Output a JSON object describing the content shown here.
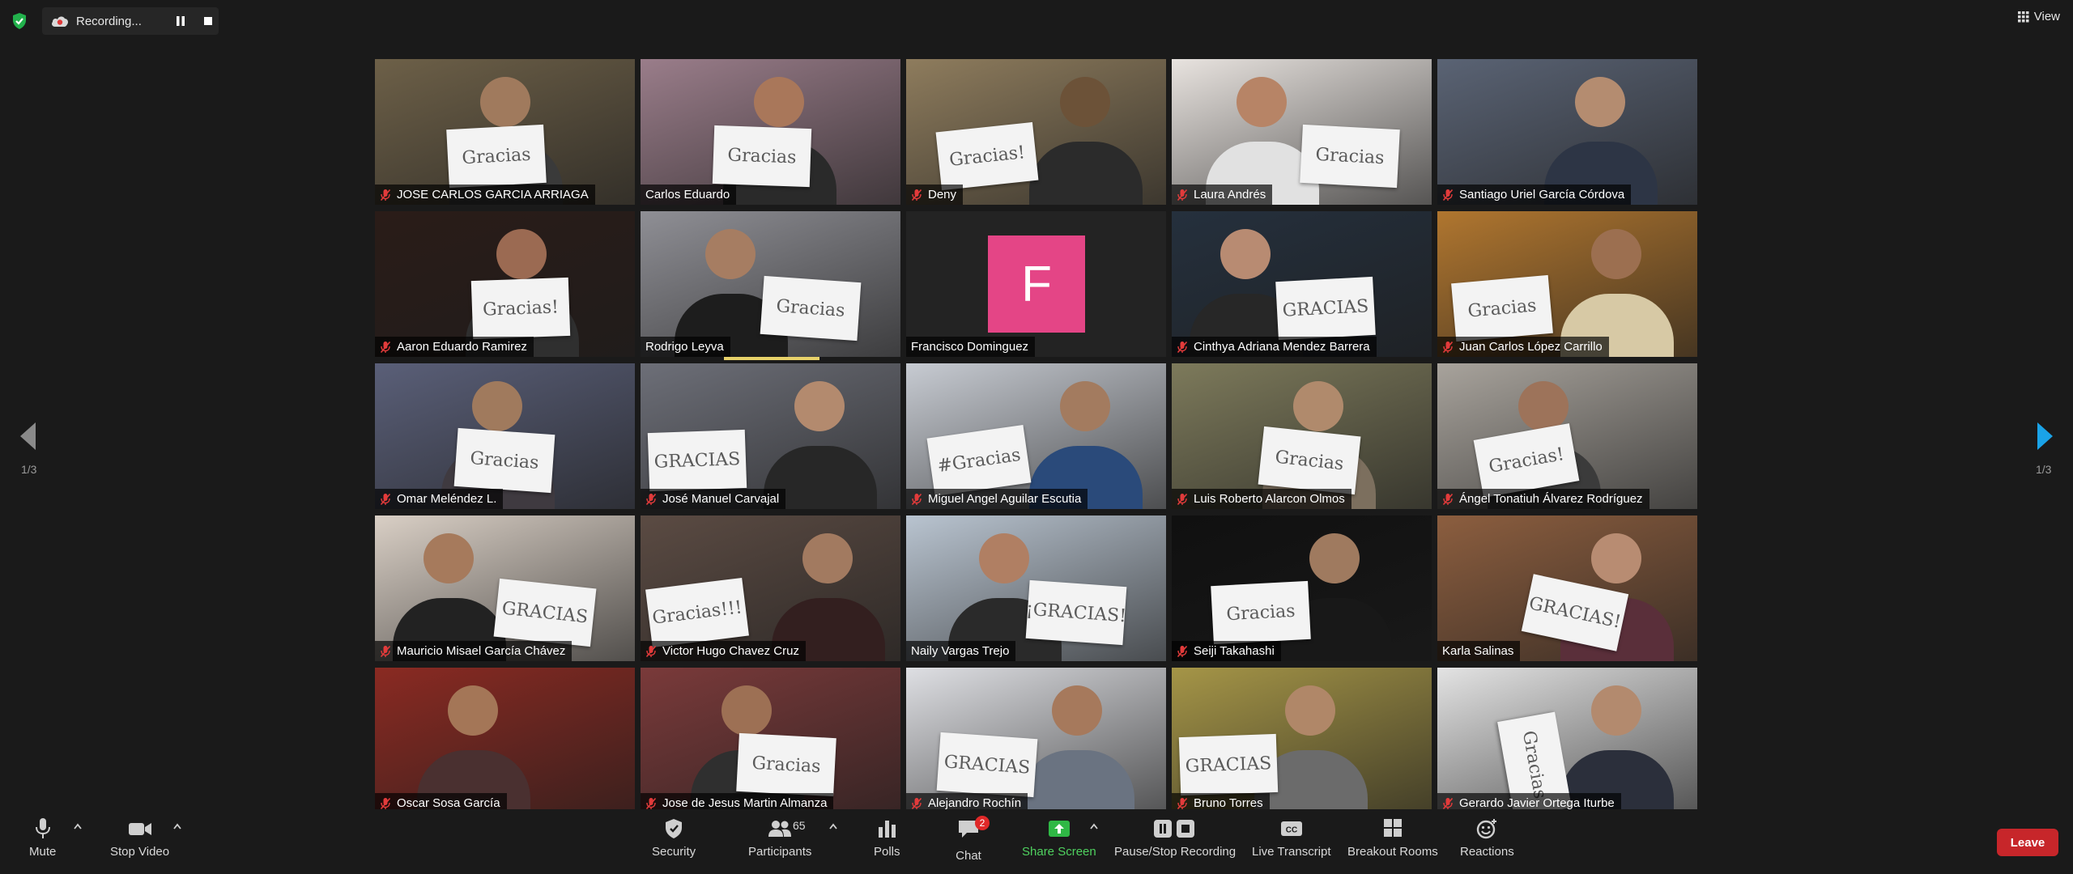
{
  "recording": {
    "label": "Recording..."
  },
  "view": {
    "label": "View"
  },
  "participants": [
    {
      "name": "JOSE CARLOS GARCIA ARRIAGA",
      "muted": true,
      "sign": "Gracias",
      "bg": "#6d6048",
      "skin": "#a07a5d",
      "shirt": "#3a3a3a"
    },
    {
      "name": "Carlos Eduardo",
      "muted": false,
      "sign": "Gracias",
      "bg": "#9a7d8a",
      "skin": "#a9775a",
      "shirt": "#2a2a2a",
      "active": true
    },
    {
      "name": "Deny",
      "muted": true,
      "sign": "Gracias!",
      "bg": "#8e7c5d",
      "skin": "#6c5238",
      "shirt": "#2b2b2b"
    },
    {
      "name": "Laura Andrés",
      "muted": true,
      "sign": "Gracias",
      "bg": "#e8e3df",
      "skin": "#b78466",
      "shirt": "#e1e1e1"
    },
    {
      "name": "Santiago Uriel García Córdova",
      "muted": true,
      "sign": "",
      "bg": "#5a6374",
      "skin": "#b48c70",
      "shirt": "#2d3545"
    },
    {
      "name": "Aaron Eduardo Ramirez",
      "muted": true,
      "sign": "Gracias!",
      "bg": "#2a1c18",
      "skin": "#9b6a52",
      "shirt": "#2f2f2f"
    },
    {
      "name": "Rodrigo Leyva",
      "muted": false,
      "sign": "Gracias",
      "bg": "#8f8f95",
      "skin": "#a67d62",
      "shirt": "#1d1d1d"
    },
    {
      "name": "Francisco Dominguez",
      "muted": false,
      "sign": "",
      "avatar": "F"
    },
    {
      "name": "Cinthya Adriana Mendez Barrera",
      "muted": true,
      "sign": "GRACIAS",
      "bg": "#25303d",
      "skin": "#b88b72",
      "shirt": "#272727"
    },
    {
      "name": "Juan Carlos López Carrillo",
      "muted": true,
      "sign": "Gracias",
      "bg": "#b0762f",
      "skin": "#9c6f50",
      "shirt": "#d7c9a5"
    },
    {
      "name": "Omar Meléndez L.",
      "muted": true,
      "sign": "Gracias",
      "bg": "#5a5f78",
      "skin": "#a07a5d",
      "shirt": "#3f3a40"
    },
    {
      "name": "José Manuel Carvajal",
      "muted": true,
      "sign": "GRACIAS",
      "bg": "#6d6f78",
      "skin": "#b38a6e",
      "shirt": "#272727"
    },
    {
      "name": "Miguel Angel Aguilar Escutia",
      "muted": true,
      "sign": "#Gracias",
      "bg": "#c7cbd2",
      "skin": "#a37b5f",
      "shirt": "#2a4a7a"
    },
    {
      "name": "Luis Roberto Alarcon Olmos",
      "muted": true,
      "sign": "Gracias",
      "bg": "#7d7a5b",
      "skin": "#b08a6c",
      "shirt": "#7c6f5e"
    },
    {
      "name": "Ángel Tonatiuh Álvarez Rodríguez",
      "muted": true,
      "sign": "Gracias!",
      "bg": "#a8a39c",
      "skin": "#9d735a",
      "shirt": "#3b3b3b"
    },
    {
      "name": "Mauricio Misael García Chávez",
      "muted": true,
      "sign": "GRACIAS",
      "bg": "#d9cfc5",
      "skin": "#a67a5c",
      "shirt": "#222222"
    },
    {
      "name": "Victor Hugo Chavez Cruz",
      "muted": true,
      "sign": "Gracias!!!",
      "bg": "#5b4b43",
      "skin": "#a27a60",
      "shirt": "#331f1f"
    },
    {
      "name": "Naily Vargas Trejo",
      "muted": false,
      "sign": "¡GRACIAS!",
      "bg": "#b9c4d0",
      "skin": "#b07f63",
      "shirt": "#2a2a2a"
    },
    {
      "name": "Seiji Takahashi",
      "muted": true,
      "sign": "Gracias",
      "bg": "#101010",
      "skin": "#9f7a5f",
      "shirt": "#181818"
    },
    {
      "name": "Karla Salinas",
      "muted": false,
      "sign": "GRACIAS!",
      "bg": "#8c5e3f",
      "skin": "#b88c72",
      "shirt": "#5a2f3a"
    },
    {
      "name": "Oscar Sosa García",
      "muted": true,
      "sign": "",
      "bg": "#8a2a22",
      "skin": "#a47657",
      "shirt": "#4a3030"
    },
    {
      "name": "Jose de Jesus Martin Almanza",
      "muted": true,
      "sign": "Gracias",
      "bg": "#7a3a3a",
      "skin": "#9d7054",
      "shirt": "#2f2f2f"
    },
    {
      "name": "Alejandro Rochín",
      "muted": true,
      "sign": "GRACIAS",
      "bg": "#dedfe3",
      "skin": "#a6795c",
      "shirt": "#6a7381"
    },
    {
      "name": "Bruno Torres",
      "muted": true,
      "sign": "GRACIAS",
      "bg": "#a59547",
      "skin": "#b08768",
      "shirt": "#6b6b6b"
    },
    {
      "name": "Gerardo Javier Ortega Iturbe",
      "muted": true,
      "sign": "Gracias",
      "bg": "#e3e3e3",
      "skin": "#b38a6e",
      "shirt": "#2b2f3b"
    }
  ],
  "pagination": {
    "left": "1/3",
    "right": "1/3"
  },
  "toolbar": {
    "mute": "Mute",
    "stop_video": "Stop Video",
    "security": "Security",
    "participants": "Participants",
    "participants_count": "65",
    "polls": "Polls",
    "chat": "Chat",
    "chat_badge": "2",
    "share_screen": "Share Screen",
    "pause_stop_recording": "Pause/Stop Recording",
    "live_transcript": "Live Transcript",
    "breakout_rooms": "Breakout Rooms",
    "reactions": "Reactions",
    "leave": "Leave"
  },
  "colors": {
    "accent_green": "#4fd15f",
    "leave_red": "#c7262a",
    "active_speaker": "#d8e26b",
    "nav_blue": "#1aa3e8"
  }
}
